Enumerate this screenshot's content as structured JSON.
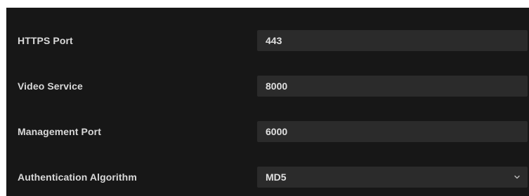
{
  "settings": {
    "rows": [
      {
        "label": "HTTPS Port",
        "value": "443"
      },
      {
        "label": "Video Service",
        "value": "8000"
      },
      {
        "label": "Management Port",
        "value": "6000"
      },
      {
        "label": "Authentication Algorithm",
        "value": "MD5"
      }
    ]
  },
  "icons": {
    "dropdown": "chevron-down-icon"
  }
}
